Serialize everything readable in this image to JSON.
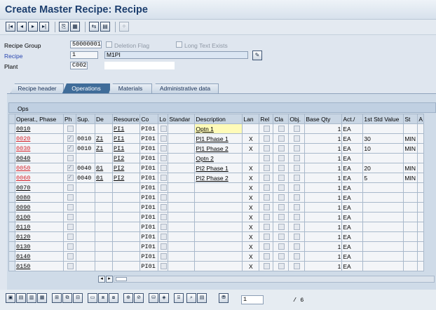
{
  "window": {
    "title": "Create Master Recipe: Recipe"
  },
  "toolbar": {
    "icons": [
      "first-page-icon",
      "previous-page-icon",
      "next-page-icon",
      "last-page-icon",
      "copy-icon",
      "materials-icon",
      "compare-icon",
      "print-icon",
      "settings-icon"
    ]
  },
  "header": {
    "recipe_group_label": "Recipe Group",
    "recipe_group_value": "50000001",
    "deletion_flag_label": "Deletion Flag",
    "long_text_label": "Long Text Exists",
    "recipe_label": "Recipe",
    "recipe_value": "1",
    "recipe_desc": "M1PI",
    "plant_label": "Plant",
    "plant_value": "C002"
  },
  "tabs": [
    {
      "label": "Recipe header",
      "active": false
    },
    {
      "label": "Operations",
      "active": true
    },
    {
      "label": "Materials",
      "active": false
    },
    {
      "label": "Administrative data",
      "active": false
    }
  ],
  "grid": {
    "title": "Ops",
    "columns": [
      "Operat., Phase",
      "Ph",
      "Sup.",
      "De",
      "Resource",
      "Co",
      "Lo",
      "Standar",
      "Description",
      "Lan",
      "Rel",
      "Cla",
      "Obj.",
      "Base Qty",
      "Act./",
      "1st Std Value",
      "St",
      "A"
    ],
    "rows": [
      {
        "op": "0010",
        "red": false,
        "phase": false,
        "sup": "",
        "dest": "",
        "resource": "PI1",
        "ctrl": "PI01",
        "desc": "Optn 1",
        "yellow": true,
        "lan": "",
        "rel": false,
        "qty": "1",
        "unit": "EA",
        "std": "",
        "stu": ""
      },
      {
        "op": "0020",
        "red": true,
        "phase": true,
        "sup": "0010",
        "dest": "Z1",
        "resource": "PI1",
        "ctrl": "PI01",
        "desc": "PI1 Phase 1",
        "yellow": false,
        "lan": "X",
        "rel": false,
        "qty": "1",
        "unit": "EA",
        "std": "30",
        "stu": "MIN"
      },
      {
        "op": "0030",
        "red": true,
        "phase": true,
        "sup": "0010",
        "dest": "Z1",
        "resource": "PI1",
        "ctrl": "PI01",
        "desc": "PI1 Phase 2",
        "yellow": false,
        "lan": "X",
        "rel": false,
        "qty": "1",
        "unit": "EA",
        "std": "10",
        "stu": "MIN"
      },
      {
        "op": "0040",
        "red": false,
        "phase": false,
        "sup": "",
        "dest": "",
        "resource": "PI2",
        "ctrl": "PI01",
        "desc": "Optn 2",
        "yellow": false,
        "lan": "",
        "rel": false,
        "qty": "1",
        "unit": "EA",
        "std": "",
        "stu": ""
      },
      {
        "op": "0050",
        "red": true,
        "phase": true,
        "sup": "0040",
        "dest": "01",
        "resource": "PI2",
        "ctrl": "PI01",
        "desc": "PI2 Phase 1",
        "yellow": false,
        "lan": "X",
        "rel": false,
        "qty": "1",
        "unit": "EA",
        "std": "20",
        "stu": "MIN"
      },
      {
        "op": "0060",
        "red": true,
        "phase": true,
        "sup": "0040",
        "dest": "01",
        "resource": "PI2",
        "ctrl": "PI01",
        "desc": "PI2 Phase 2",
        "yellow": false,
        "lan": "X",
        "rel": false,
        "qty": "1",
        "unit": "EA",
        "std": "5",
        "stu": "MIN"
      },
      {
        "op": "0070",
        "red": false,
        "phase": false,
        "sup": "",
        "dest": "",
        "resource": "",
        "ctrl": "PI01",
        "desc": "",
        "yellow": false,
        "lan": "X",
        "rel": false,
        "qty": "1",
        "unit": "EA",
        "std": "",
        "stu": ""
      },
      {
        "op": "0080",
        "red": false,
        "phase": false,
        "sup": "",
        "dest": "",
        "resource": "",
        "ctrl": "PI01",
        "desc": "",
        "yellow": false,
        "lan": "X",
        "rel": false,
        "qty": "1",
        "unit": "EA",
        "std": "",
        "stu": ""
      },
      {
        "op": "0090",
        "red": false,
        "phase": false,
        "sup": "",
        "dest": "",
        "resource": "",
        "ctrl": "PI01",
        "desc": "",
        "yellow": false,
        "lan": "X",
        "rel": false,
        "qty": "1",
        "unit": "EA",
        "std": "",
        "stu": ""
      },
      {
        "op": "0100",
        "red": false,
        "phase": false,
        "sup": "",
        "dest": "",
        "resource": "",
        "ctrl": "PI01",
        "desc": "",
        "yellow": false,
        "lan": "X",
        "rel": false,
        "qty": "1",
        "unit": "EA",
        "std": "",
        "stu": ""
      },
      {
        "op": "0110",
        "red": false,
        "phase": false,
        "sup": "",
        "dest": "",
        "resource": "",
        "ctrl": "PI01",
        "desc": "",
        "yellow": false,
        "lan": "X",
        "rel": false,
        "qty": "1",
        "unit": "EA",
        "std": "",
        "stu": ""
      },
      {
        "op": "0120",
        "red": false,
        "phase": false,
        "sup": "",
        "dest": "",
        "resource": "",
        "ctrl": "PI01",
        "desc": "",
        "yellow": false,
        "lan": "X",
        "rel": false,
        "qty": "1",
        "unit": "EA",
        "std": "",
        "stu": ""
      },
      {
        "op": "0130",
        "red": false,
        "phase": false,
        "sup": "",
        "dest": "",
        "resource": "",
        "ctrl": "PI01",
        "desc": "",
        "yellow": false,
        "lan": "X",
        "rel": false,
        "qty": "1",
        "unit": "EA",
        "std": "",
        "stu": ""
      },
      {
        "op": "0140",
        "red": false,
        "phase": false,
        "sup": "",
        "dest": "",
        "resource": "",
        "ctrl": "PI01",
        "desc": "",
        "yellow": false,
        "lan": "X",
        "rel": false,
        "qty": "1",
        "unit": "EA",
        "std": "",
        "stu": ""
      },
      {
        "op": "0150",
        "red": false,
        "phase": false,
        "sup": "",
        "dest": "",
        "resource": "",
        "ctrl": "PI01",
        "desc": "",
        "yellow": false,
        "lan": "X",
        "rel": false,
        "qty": "1",
        "unit": "EA",
        "std": "",
        "stu": ""
      }
    ]
  },
  "footer": {
    "page_value": "1",
    "page_total": "/ 6"
  },
  "colors": {
    "title": "#1c3e6e",
    "active_tab": "#3f6c99",
    "red_link": "#d3202a",
    "yellow_row": "#fffbb8"
  }
}
